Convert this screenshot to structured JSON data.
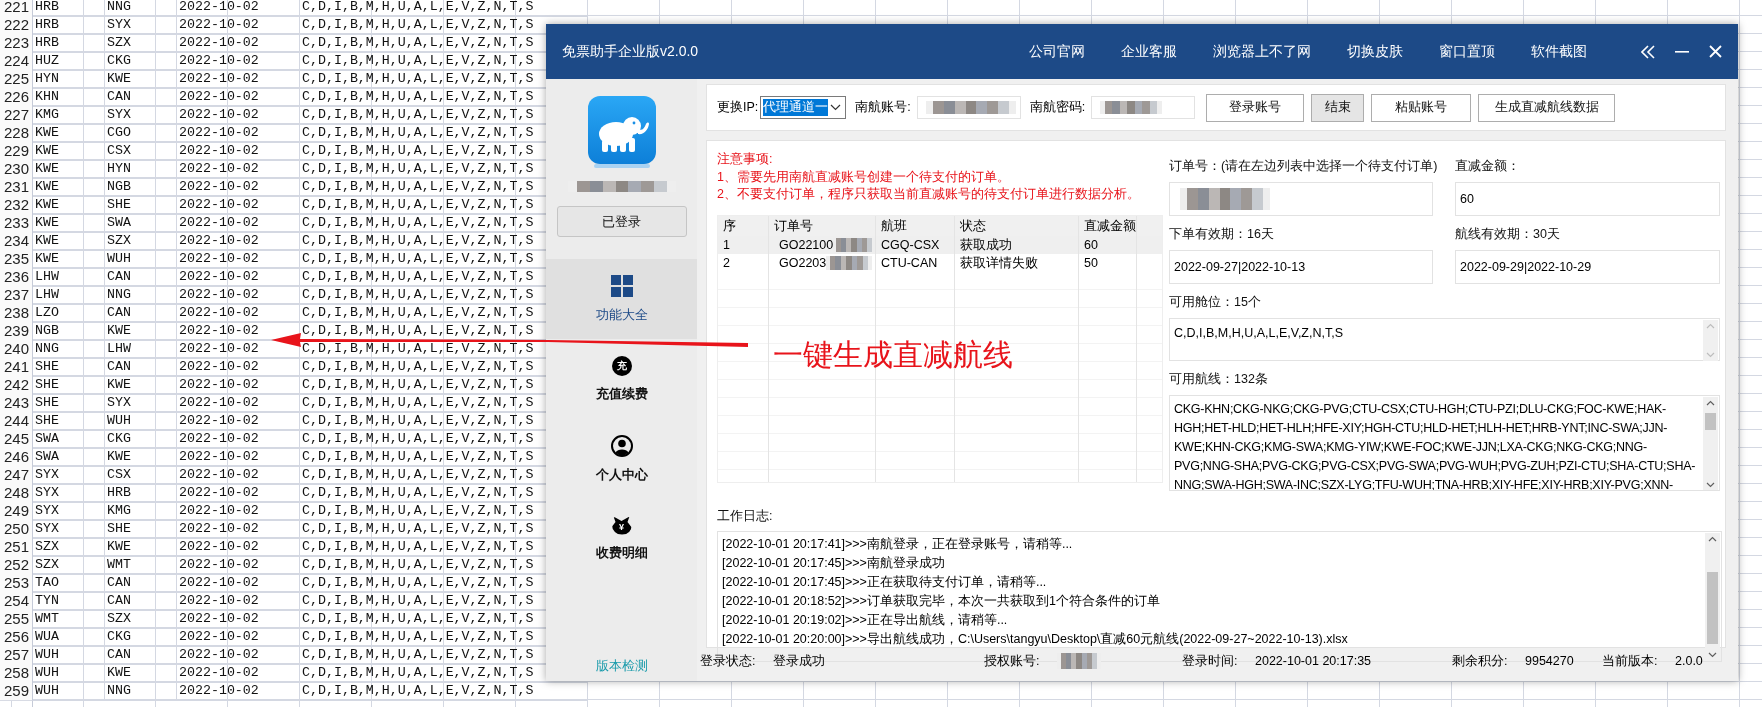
{
  "spreadsheet": {
    "rows": [
      {
        "row": "221",
        "cells": [
          "HRB",
          "NNG",
          "2022-10-02",
          "C,D,I,B,M,H,U,A,L,E,V,Z,N,T,S"
        ]
      },
      {
        "row": "222",
        "cells": [
          "HRB",
          "SYX",
          "2022-10-02",
          "C,D,I,B,M,H,U,A,L,E,V,Z,N,T,S"
        ]
      },
      {
        "row": "223",
        "cells": [
          "HRB",
          "SZX",
          "2022-10-02",
          "C,D,I,B,M,H,U,A,L,E,V,Z,N,T,S"
        ]
      },
      {
        "row": "224",
        "cells": [
          "HUZ",
          "CKG",
          "2022-10-02",
          "C,D,I,B,M,H,U,A,L,E,V,Z,N,T,S"
        ]
      },
      {
        "row": "225",
        "cells": [
          "HYN",
          "KWE",
          "2022-10-02",
          "C,D,I,B,M,H,U,A,L,E,V,Z,N,T,S"
        ]
      },
      {
        "row": "226",
        "cells": [
          "KHN",
          "CAN",
          "2022-10-02",
          "C,D,I,B,M,H,U,A,L,E,V,Z,N,T,S"
        ]
      },
      {
        "row": "227",
        "cells": [
          "KMG",
          "SYX",
          "2022-10-02",
          "C,D,I,B,M,H,U,A,L,E,V,Z,N,T,S"
        ]
      },
      {
        "row": "228",
        "cells": [
          "KWE",
          "CGO",
          "2022-10-02",
          "C,D,I,B,M,H,U,A,L,E,V,Z,N,T,S"
        ]
      },
      {
        "row": "229",
        "cells": [
          "KWE",
          "CSX",
          "2022-10-02",
          "C,D,I,B,M,H,U,A,L,E,V,Z,N,T,S"
        ]
      },
      {
        "row": "230",
        "cells": [
          "KWE",
          "HYN",
          "2022-10-02",
          "C,D,I,B,M,H,U,A,L,E,V,Z,N,T,S"
        ]
      },
      {
        "row": "231",
        "cells": [
          "KWE",
          "NGB",
          "2022-10-02",
          "C,D,I,B,M,H,U,A,L,E,V,Z,N,T,S"
        ]
      },
      {
        "row": "232",
        "cells": [
          "KWE",
          "SHE",
          "2022-10-02",
          "C,D,I,B,M,H,U,A,L,E,V,Z,N,T,S"
        ]
      },
      {
        "row": "233",
        "cells": [
          "KWE",
          "SWA",
          "2022-10-02",
          "C,D,I,B,M,H,U,A,L,E,V,Z,N,T,S"
        ]
      },
      {
        "row": "234",
        "cells": [
          "KWE",
          "SZX",
          "2022-10-02",
          "C,D,I,B,M,H,U,A,L,E,V,Z,N,T,S"
        ]
      },
      {
        "row": "235",
        "cells": [
          "KWE",
          "WUH",
          "2022-10-02",
          "C,D,I,B,M,H,U,A,L,E,V,Z,N,T,S"
        ]
      },
      {
        "row": "236",
        "cells": [
          "LHW",
          "CAN",
          "2022-10-02",
          "C,D,I,B,M,H,U,A,L,E,V,Z,N,T,S"
        ]
      },
      {
        "row": "237",
        "cells": [
          "LHW",
          "NNG",
          "2022-10-02",
          "C,D,I,B,M,H,U,A,L,E,V,Z,N,T,S"
        ]
      },
      {
        "row": "238",
        "cells": [
          "LZO",
          "CAN",
          "2022-10-02",
          "C,D,I,B,M,H,U,A,L,E,V,Z,N,T,S"
        ]
      },
      {
        "row": "239",
        "cells": [
          "NGB",
          "KWE",
          "2022-10-02",
          "C,D,I,B,M,H,U,A,L,E,V,Z,N,T,S"
        ]
      },
      {
        "row": "240",
        "cells": [
          "NNG",
          "LHW",
          "2022-10-02",
          "C,D,I,B,M,H,U,A,L,E,V,Z,N,T,S"
        ]
      },
      {
        "row": "241",
        "cells": [
          "SHE",
          "CAN",
          "2022-10-02",
          "C,D,I,B,M,H,U,A,L,E,V,Z,N,T,S"
        ]
      },
      {
        "row": "242",
        "cells": [
          "SHE",
          "KWE",
          "2022-10-02",
          "C,D,I,B,M,H,U,A,L,E,V,Z,N,T,S"
        ]
      },
      {
        "row": "243",
        "cells": [
          "SHE",
          "SYX",
          "2022-10-02",
          "C,D,I,B,M,H,U,A,L,E,V,Z,N,T,S"
        ]
      },
      {
        "row": "244",
        "cells": [
          "SHE",
          "WUH",
          "2022-10-02",
          "C,D,I,B,M,H,U,A,L,E,V,Z,N,T,S"
        ]
      },
      {
        "row": "245",
        "cells": [
          "SWA",
          "CKG",
          "2022-10-02",
          "C,D,I,B,M,H,U,A,L,E,V,Z,N,T,S"
        ]
      },
      {
        "row": "246",
        "cells": [
          "SWA",
          "KWE",
          "2022-10-02",
          "C,D,I,B,M,H,U,A,L,E,V,Z,N,T,S"
        ]
      },
      {
        "row": "247",
        "cells": [
          "SYX",
          "CSX",
          "2022-10-02",
          "C,D,I,B,M,H,U,A,L,E,V,Z,N,T,S"
        ]
      },
      {
        "row": "248",
        "cells": [
          "SYX",
          "HRB",
          "2022-10-02",
          "C,D,I,B,M,H,U,A,L,E,V,Z,N,T,S"
        ]
      },
      {
        "row": "249",
        "cells": [
          "SYX",
          "KMG",
          "2022-10-02",
          "C,D,I,B,M,H,U,A,L,E,V,Z,N,T,S"
        ]
      },
      {
        "row": "250",
        "cells": [
          "SYX",
          "SHE",
          "2022-10-02",
          "C,D,I,B,M,H,U,A,L,E,V,Z,N,T,S"
        ]
      },
      {
        "row": "251",
        "cells": [
          "SZX",
          "KWE",
          "2022-10-02",
          "C,D,I,B,M,H,U,A,L,E,V,Z,N,T,S"
        ]
      },
      {
        "row": "252",
        "cells": [
          "SZX",
          "WMT",
          "2022-10-02",
          "C,D,I,B,M,H,U,A,L,E,V,Z,N,T,S"
        ]
      },
      {
        "row": "253",
        "cells": [
          "TAO",
          "CAN",
          "2022-10-02",
          "C,D,I,B,M,H,U,A,L,E,V,Z,N,T,S"
        ]
      },
      {
        "row": "254",
        "cells": [
          "TYN",
          "CAN",
          "2022-10-02",
          "C,D,I,B,M,H,U,A,L,E,V,Z,N,T,S"
        ]
      },
      {
        "row": "255",
        "cells": [
          "WMT",
          "SZX",
          "2022-10-02",
          "C,D,I,B,M,H,U,A,L,E,V,Z,N,T,S"
        ]
      },
      {
        "row": "256",
        "cells": [
          "WUA",
          "CKG",
          "2022-10-02",
          "C,D,I,B,M,H,U,A,L,E,V,Z,N,T,S"
        ]
      },
      {
        "row": "257",
        "cells": [
          "WUH",
          "CAN",
          "2022-10-02",
          "C,D,I,B,M,H,U,A,L,E,V,Z,N,T,S"
        ]
      },
      {
        "row": "258",
        "cells": [
          "WUH",
          "KWE",
          "2022-10-02",
          "C,D,I,B,M,H,U,A,L,E,V,Z,N,T,S"
        ]
      },
      {
        "row": "259",
        "cells": [
          "WUH",
          "NNG",
          "2022-10-02",
          "C,D,I,B,M,H,U,A,L,E,V,Z,N,T,S"
        ]
      }
    ]
  },
  "window": {
    "title": "免票助手企业版v2.0.0",
    "menu": [
      "公司官网",
      "企业客服",
      "浏览器上不了网",
      "切换皮肤",
      "窗口置顶",
      "软件截图"
    ]
  },
  "sidebar": {
    "user_name_blurred": true,
    "login_button": "已登录",
    "nav": [
      {
        "label": "功能大全",
        "kind": "grid",
        "selected": true
      },
      {
        "label": "充值续费",
        "kind": "badge",
        "badge": "充",
        "selected": false
      },
      {
        "label": "个人中心",
        "kind": "person",
        "selected": false
      },
      {
        "label": "收费明细",
        "kind": "bag",
        "badge": "¥",
        "selected": false
      }
    ],
    "version_link": "版本检测"
  },
  "toolbar": {
    "ip_label": "更换IP:",
    "ip_select": "代理通道一",
    "account_label": "南航账号:",
    "account_blurred": true,
    "password_label": "南航密码:",
    "password_blurred": true,
    "buttons": [
      {
        "label": "登录账号",
        "highlighted": false
      },
      {
        "label": "结束",
        "highlighted": true
      },
      {
        "label": "粘贴账号",
        "highlighted": false
      },
      {
        "label": "生成直减航线数据",
        "highlighted": false
      }
    ]
  },
  "notice": {
    "title": "注意事项:",
    "lines": [
      "1、需要先用南航直减账号创建一个待支付的订单。",
      "2、不要支付订单，程序只获取当前直减账号的待支付订单进行数据分析。"
    ]
  },
  "orders": {
    "columns": [
      "序",
      "订单号",
      "航班",
      "状态",
      "直减金额"
    ],
    "rows": [
      {
        "seq": "1",
        "order": "GO22100",
        "order_blurred": true,
        "flight": "CGQ-CSX",
        "status": "获取成功",
        "amount": "60",
        "selected": true
      },
      {
        "seq": "2",
        "order": "GO2203",
        "order_blurred": true,
        "flight": "CTU-CAN",
        "status": "获取详情失败",
        "amount": "50",
        "selected": false
      }
    ]
  },
  "details": {
    "order_label": "订单号：(请在左边列表中选择一个待支付订单)",
    "order_blurred": true,
    "amount_label": "直减金额：",
    "amount": "60",
    "order_valid_label": "下单有效期：16天",
    "order_valid": "2022-09-27|2022-10-13",
    "route_valid_label": "航线有效期：30天",
    "route_valid": "2022-09-29|2022-10-29",
    "cabins_label": "可用舱位：15个",
    "cabins": "C,D,I,B,M,H,U,A,L,E,V,Z,N,T,S",
    "routes_label": "可用航线：132条",
    "routes": "CKG-KHN;CKG-NKG;CKG-PVG;CTU-CSX;CTU-HGH;CTU-PZI;DLU-CKG;FOC-KWE;HAK-HGH;HET-HLD;HET-HLH;HFE-XIY;HGH-CTU;HLD-HET;HLH-HET;HRB-YNT;INC-SWA;JJN-KWE;KHN-CKG;KMG-SWA;KMG-YIW;KWE-FOC;KWE-JJN;LXA-CKG;NKG-CKG;NNG-PVG;NNG-SHA;PVG-CKG;PVG-CSX;PVG-SWA;PVG-WUH;PVG-ZUH;PZI-CTU;SHA-CTU;SHA-NNG;SWA-HGH;SWA-INC;SZX-LYG;TFU-WUH;TNA-HRB;XIY-HFE;XIY-HRB;XIY-PVG;XNN-"
  },
  "log": {
    "label": "工作日志:",
    "lines": [
      "[2022-10-01 20:17:41]>>>南航登录，正在登录账号，请稍等...",
      "[2022-10-01 20:17:45]>>>南航登录成功",
      "[2022-10-01 20:17:45]>>>正在获取待支付订单，请稍等...",
      "[2022-10-01 20:18:52]>>>订单获取完毕，本次一共获取到1个符合条件的订单",
      "[2022-10-01 20:19:02]>>>正在导出航线，请稍等...",
      "[2022-10-01 20:20:00]>>>导出航线成功，C:\\Users\\tangyu\\Desktop\\直减60元航线(2022-09-27~2022-10-13).xlsx"
    ]
  },
  "status_bar": [
    {
      "label": "登录状态:",
      "value": "登录成功"
    },
    {
      "label": "授权账号:",
      "blurred": true
    },
    {
      "label": "登录时间:",
      "value": "2022-10-01 20:17:35"
    },
    {
      "label": "剩余积分:",
      "value": "9954270"
    },
    {
      "label": "当前版本:",
      "value": "2.0.0"
    }
  ],
  "annotation": {
    "text": "一键生成直减航线"
  }
}
